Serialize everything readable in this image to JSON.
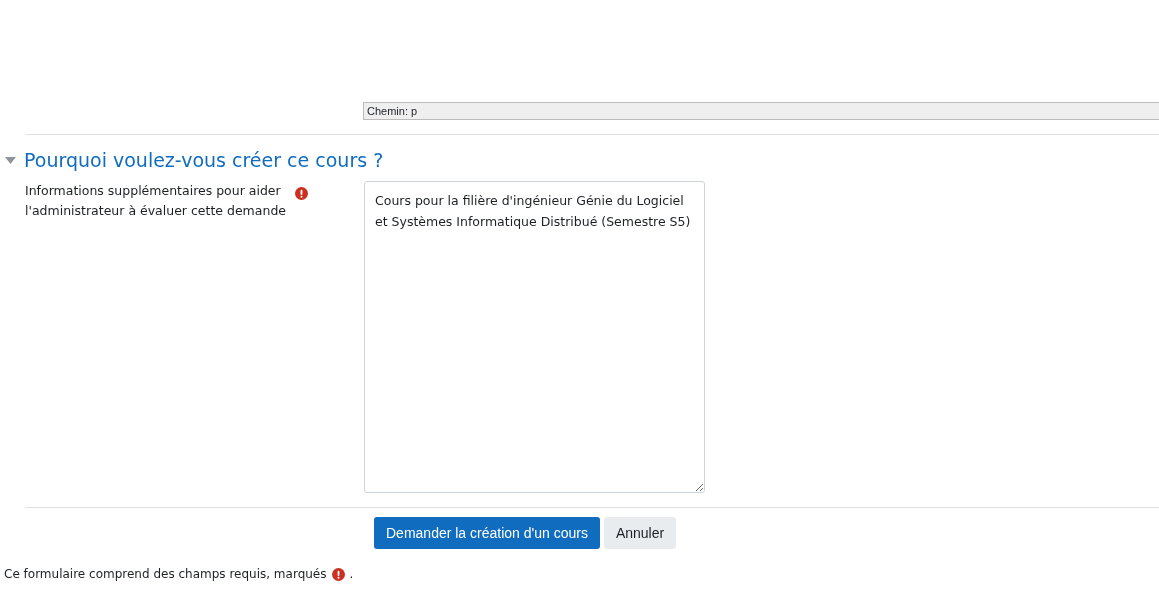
{
  "path_bar": {
    "text": "Chemin: p"
  },
  "section": {
    "title": "Pourquoi voulez-vous créer ce cours ?",
    "expanded": true
  },
  "field": {
    "label": "Informations supplémentaires pour aider l'administrateur à évaluer cette demande",
    "required": true,
    "value": "Cours pour la filière d'ingénieur Génie du Logiciel et Systèmes Informatique Distribué (Semestre S5)"
  },
  "buttons": [
    {
      "label": "Demander la création d'un cours",
      "kind": "primary"
    },
    {
      "label": "Annuler",
      "kind": "secondary"
    }
  ],
  "footer": {
    "before": "Ce formulaire comprend des champs requis, marqués",
    "after": "."
  }
}
